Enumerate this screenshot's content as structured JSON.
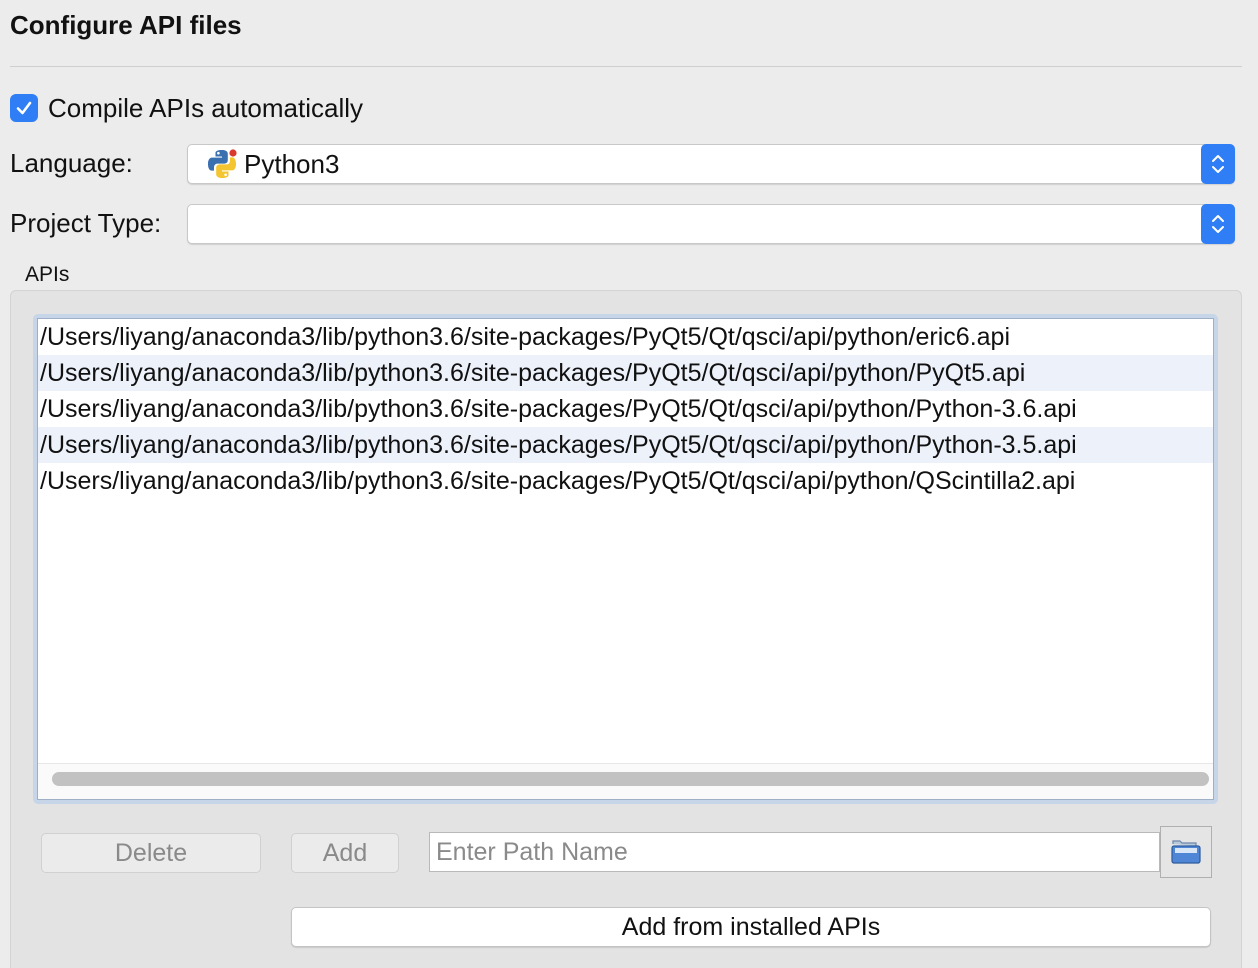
{
  "page": {
    "title": "Configure API files"
  },
  "compile": {
    "label": "Compile APIs automatically",
    "checked": true
  },
  "language": {
    "label": "Language:",
    "value": "Python3",
    "icon": "python-icon"
  },
  "project_type": {
    "label": "Project Type:",
    "value": ""
  },
  "apis": {
    "group_title": "APIs",
    "items": [
      "/Users/liyang/anaconda3/lib/python3.6/site-packages/PyQt5/Qt/qsci/api/python/eric6.api",
      "/Users/liyang/anaconda3/lib/python3.6/site-packages/PyQt5/Qt/qsci/api/python/PyQt5.api",
      "/Users/liyang/anaconda3/lib/python3.6/site-packages/PyQt5/Qt/qsci/api/python/Python-3.6.api",
      "/Users/liyang/anaconda3/lib/python3.6/site-packages/PyQt5/Qt/qsci/api/python/Python-3.5.api",
      "/Users/liyang/anaconda3/lib/python3.6/site-packages/PyQt5/Qt/qsci/api/python/QScintilla2.api"
    ]
  },
  "actions": {
    "delete_label": "Delete",
    "add_label": "Add",
    "path_placeholder": "Enter Path Name",
    "path_value": "",
    "browse_icon": "folder-open-icon",
    "add_installed_label": "Add from installed APIs"
  },
  "colors": {
    "accent": "#2f7ef5",
    "alt_row": "#edf1fa",
    "list_frame": "#c7d5e8"
  }
}
